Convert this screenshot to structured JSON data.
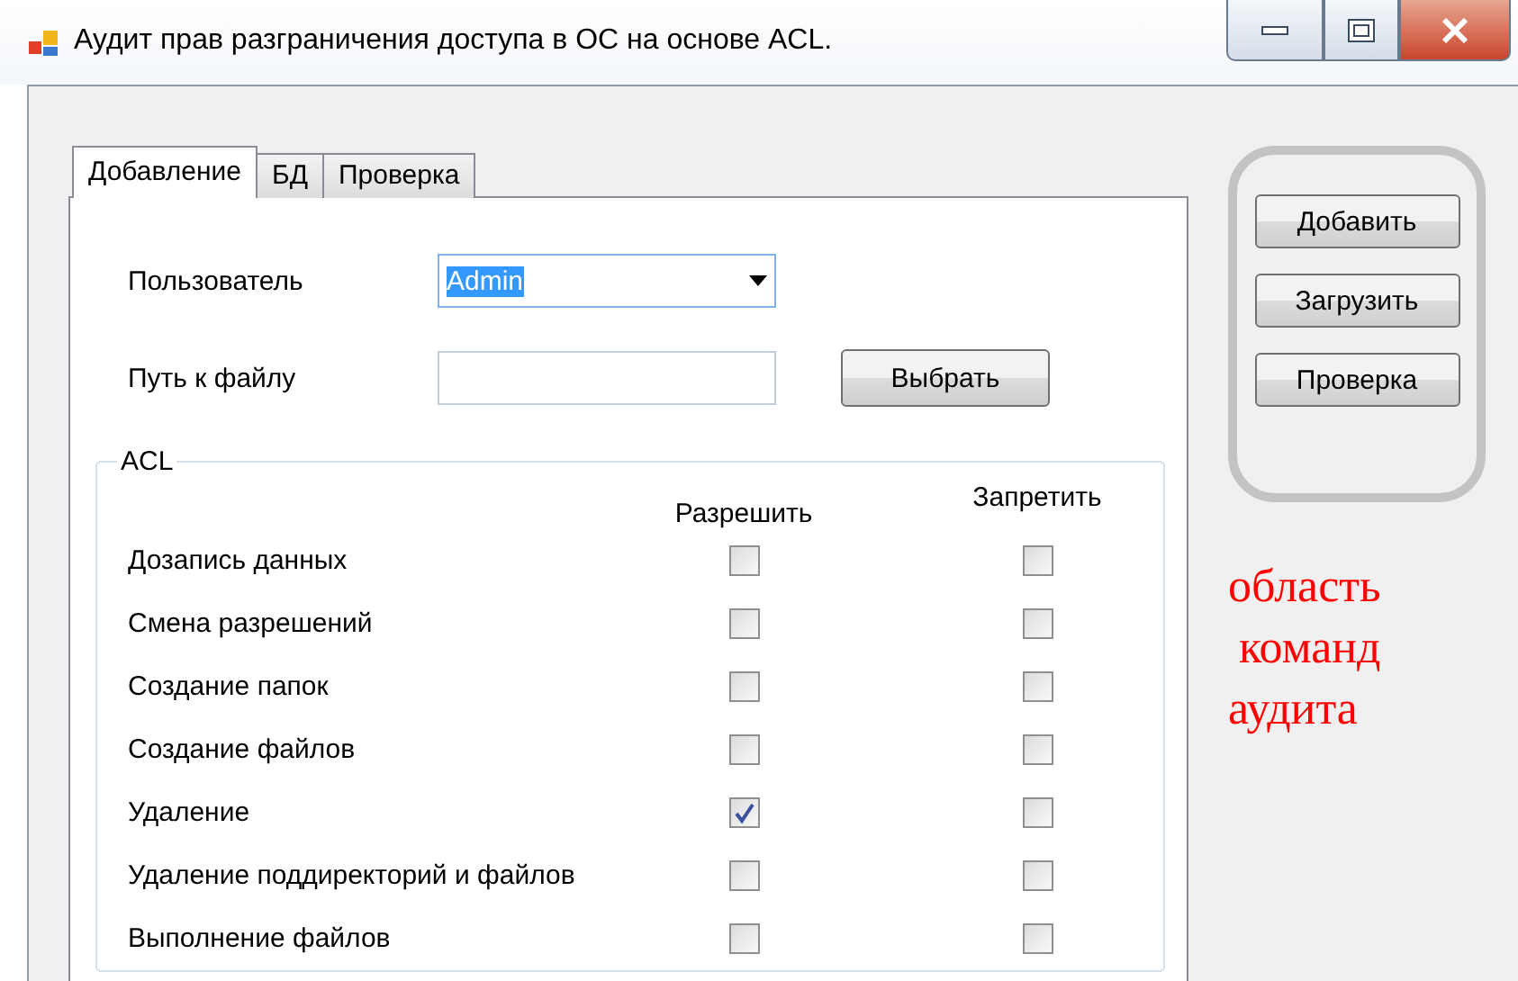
{
  "window": {
    "title": "Аудит прав разграничения доступа в ОС на основе ACL."
  },
  "tabs": [
    {
      "label": "Добавление",
      "selected": true
    },
    {
      "label": "БД",
      "selected": false
    },
    {
      "label": "Проверка",
      "selected": false
    }
  ],
  "user": {
    "label": "Пользователь",
    "value": "Admin",
    "value_highlighted": true
  },
  "file_path": {
    "label": "Путь к файлу",
    "button": "Выбрать"
  },
  "acl": {
    "title": "ACL",
    "columns": [
      "Разрешить",
      "Запретить"
    ],
    "rows": [
      {
        "label": "Дозапись данных",
        "allow": false,
        "deny": false
      },
      {
        "label": "Смена разрешений",
        "allow": false,
        "deny": false
      },
      {
        "label": "Создание папок",
        "allow": false,
        "deny": false
      },
      {
        "label": "Создание файлов",
        "allow": false,
        "deny": false
      },
      {
        "label": "Удаление",
        "allow": true,
        "deny": false
      },
      {
        "label": "Удаление поддиректорий и файлов",
        "allow": false,
        "deny": false
      },
      {
        "label": "Выполнение файлов",
        "allow": false,
        "deny": false
      }
    ]
  },
  "commands": [
    "Добавить",
    "Загрузить",
    "Проверка"
  ],
  "annotation": [
    "область",
    "команд",
    "аудита"
  ]
}
